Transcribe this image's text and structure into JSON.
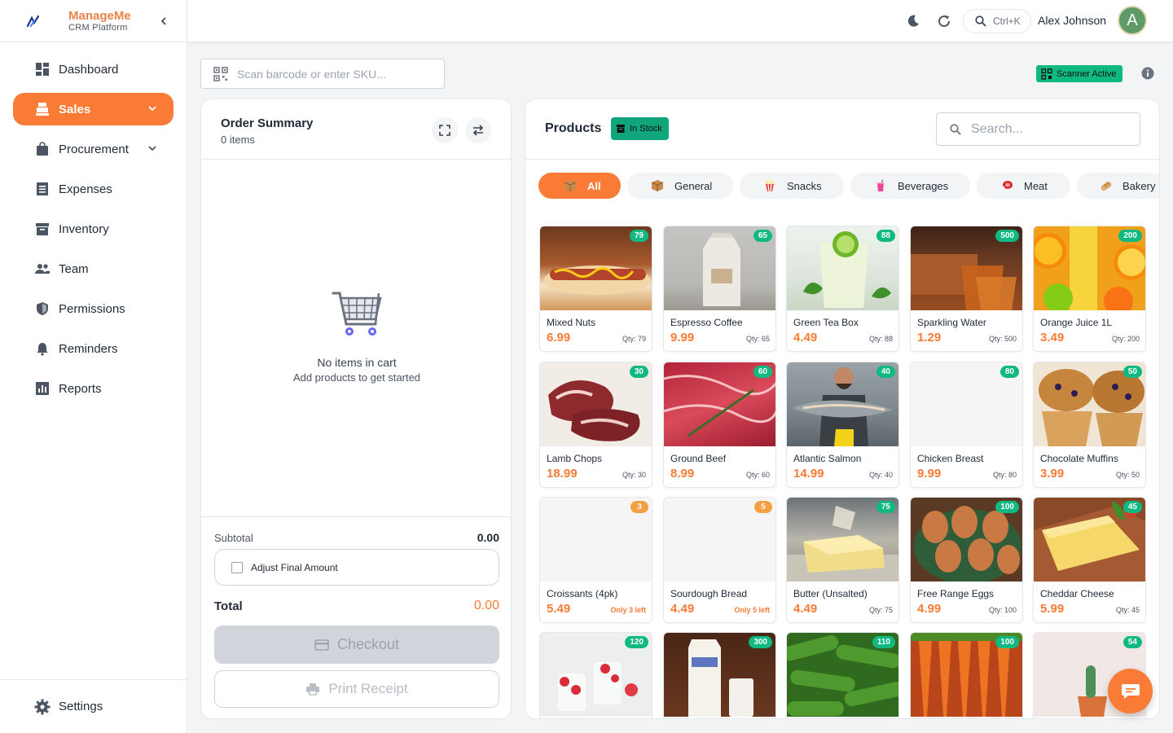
{
  "brand": {
    "title": "ManageMe",
    "subtitle": "CRM Platform"
  },
  "nav": [
    {
      "label": "Dashboard"
    },
    {
      "label": "Sales"
    },
    {
      "label": "Procurement"
    },
    {
      "label": "Expenses"
    },
    {
      "label": "Inventory"
    },
    {
      "label": "Team"
    },
    {
      "label": "Permissions"
    },
    {
      "label": "Reminders"
    },
    {
      "label": "Reports"
    }
  ],
  "settings_label": "Settings",
  "topbar": {
    "search_shortcut": "Ctrl+K",
    "user_name": "Alex Johnson",
    "avatar_letter": "A"
  },
  "barcode": {
    "placeholder": "Scan barcode or enter SKU..."
  },
  "scanner_status": "Scanner Active",
  "order": {
    "title": "Order Summary",
    "count": "0 items",
    "empty_title": "No items in cart",
    "empty_sub": "Add products to get started",
    "subtotal_label": "Subtotal",
    "subtotal_value": "0.00",
    "adjust_label": "Adjust Final Amount",
    "total_label": "Total",
    "total_value": "0.00",
    "checkout_label": "Checkout",
    "print_label": "Print Receipt"
  },
  "products": {
    "title": "Products",
    "stock_filter": "In Stock",
    "search_placeholder": "Search...",
    "categories": [
      {
        "label": "All"
      },
      {
        "label": "General"
      },
      {
        "label": "Snacks"
      },
      {
        "label": "Beverages"
      },
      {
        "label": "Meat"
      },
      {
        "label": "Bakery"
      }
    ],
    "items": [
      {
        "name": "Mixed Nuts",
        "price": "6.99",
        "qty": "Qty: 79",
        "badge": "79"
      },
      {
        "name": "Espresso Coffee",
        "price": "9.99",
        "qty": "Qty: 65",
        "badge": "65"
      },
      {
        "name": "Green Tea Box",
        "price": "4.49",
        "qty": "Qty: 88",
        "badge": "88"
      },
      {
        "name": "Sparkling Water",
        "price": "1.29",
        "qty": "Qty: 500",
        "badge": "500"
      },
      {
        "name": "Orange Juice 1L",
        "price": "3.49",
        "qty": "Qty: 200",
        "badge": "200"
      },
      {
        "name": "Lamb Chops",
        "price": "18.99",
        "qty": "Qty: 30",
        "badge": "30"
      },
      {
        "name": "Ground Beef",
        "price": "8.99",
        "qty": "Qty: 60",
        "badge": "60"
      },
      {
        "name": "Atlantic Salmon",
        "price": "14.99",
        "qty": "Qty: 40",
        "badge": "40"
      },
      {
        "name": "Chicken Breast",
        "price": "9.99",
        "qty": "Qty: 80",
        "badge": "80"
      },
      {
        "name": "Chocolate Muffins",
        "price": "3.99",
        "qty": "Qty: 50",
        "badge": "50"
      },
      {
        "name": "Croissants (4pk)",
        "price": "5.49",
        "qty": "Only 3 left",
        "badge": "3"
      },
      {
        "name": "Sourdough Bread",
        "price": "4.49",
        "qty": "Only 5 left",
        "badge": "5"
      },
      {
        "name": "Butter (Unsalted)",
        "price": "4.49",
        "qty": "Qty: 75",
        "badge": "75"
      },
      {
        "name": "Free Range Eggs",
        "price": "4.99",
        "qty": "Qty: 100",
        "badge": "100"
      },
      {
        "name": "Cheddar Cheese",
        "price": "5.99",
        "qty": "Qty: 45",
        "badge": "45"
      },
      {
        "name": "",
        "price": "",
        "qty": "",
        "badge": "120"
      },
      {
        "name": "",
        "price": "",
        "qty": "",
        "badge": "300"
      },
      {
        "name": "",
        "price": "",
        "qty": "",
        "badge": "110"
      },
      {
        "name": "",
        "price": "",
        "qty": "",
        "badge": "100"
      },
      {
        "name": "",
        "price": "",
        "qty": "",
        "badge": "54"
      }
    ]
  },
  "colors": {
    "accent": "#f97b36",
    "success": "#10b981",
    "warning": "#f59e42"
  }
}
